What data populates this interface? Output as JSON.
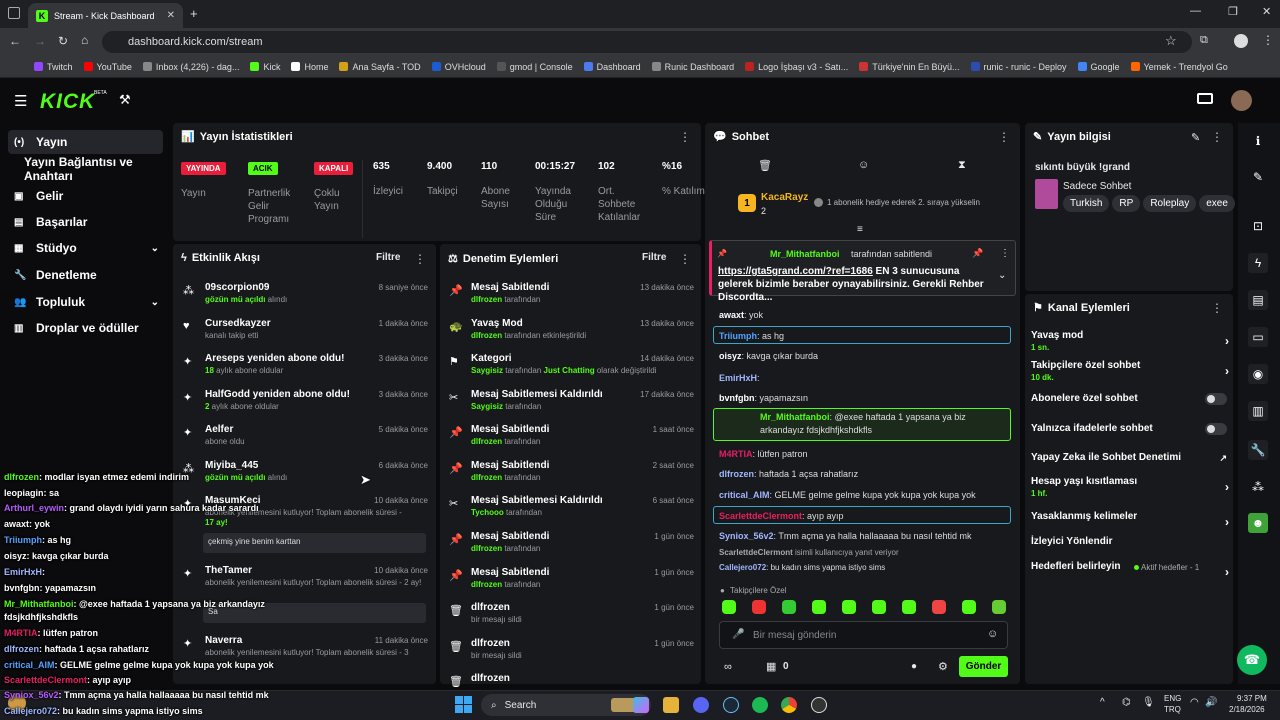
{
  "browser": {
    "tab_title": "Stream - Kick Dashboard",
    "url": "dashboard.kick.com/stream",
    "bookmarks": [
      "Twitch",
      "YouTube",
      "Inbox (4,226) - dag...",
      "Kick",
      "Home",
      "Ana Sayfa - TOD",
      "OVHcloud",
      "gmod | Console",
      "Dashboard",
      "Runic Dashboard",
      "Logo İşbaşı v3 - Satı...",
      "Türkiye'nin En Büyü...",
      "runic - runic - Deploy",
      "Google",
      "Yemek - Trendyol Go"
    ]
  },
  "sidebar": {
    "items": [
      "Yayın",
      "Yayın Bağlantısı ve Anahtarı",
      "Gelir",
      "Başarılar",
      "Stüdyo",
      "Denetleme",
      "Topluluk",
      "Droplar ve ödüller"
    ]
  },
  "stats": {
    "title": "Yayın İstatistikleri",
    "badges": [
      {
        "text": "YAYINDA",
        "label": "Yayın"
      },
      {
        "text": "ACIK",
        "label": "Partnerlik Gelir Programı"
      },
      {
        "text": "KAPALI",
        "label": "Çoklu Yayın"
      }
    ],
    "metrics": [
      {
        "value": "635",
        "label": "İzleyici"
      },
      {
        "value": "9.400",
        "label": "Takipçi"
      },
      {
        "value": "110",
        "label": "Abone Sayısı"
      },
      {
        "value": "00:15:27",
        "label": "Yayında Olduğu Süre"
      },
      {
        "value": "102",
        "label": "Ort. Sohbete Katılanlar"
      },
      {
        "value": "%16",
        "label": "% Katılım"
      }
    ]
  },
  "activity": {
    "title": "Etkinlik Akışı",
    "filter": "Filtre",
    "items": [
      {
        "title": "09scorpion09",
        "sub_hl": "gözün mü açıldı",
        "sub": " alındı",
        "time": "8 saniye önce"
      },
      {
        "title": "Cursedkayzer",
        "sub_hl": "",
        "sub": "kanalı takip etti",
        "time": "1 dakika önce"
      },
      {
        "title": "Areseps yeniden abone oldu!",
        "sub_hl": "18",
        "sub": " aylık abone oldular",
        "time": "3 dakika önce"
      },
      {
        "title": "HalfGodd yeniden abone oldu!",
        "sub_hl": "2",
        "sub": " aylık abone oldular",
        "time": "3 dakika önce"
      },
      {
        "title": "Aelfer",
        "sub_hl": "",
        "sub": "abone oldu",
        "time": "5 dakika önce"
      },
      {
        "title": "Miyiba_445",
        "sub_hl": "gözün mü açıldı",
        "sub": " alındı",
        "time": "6 dakika önce"
      },
      {
        "title": "MasumKeci",
        "sub_hl": "",
        "sub": "abonelik yenilemesini kutluyor! Toplam abonelik süresi - ",
        "sub2": "17 ay!",
        "msg": "çekmiş yine benim karttan",
        "time": "10 dakika önce"
      },
      {
        "title": "TheTamer",
        "sub_hl": "",
        "sub": "abonelik yenilemesini kutluyor! Toplam abonelik süresi - 2 ay!",
        "msg": "Sa",
        "time": "10 dakika önce"
      },
      {
        "title": "Naverra",
        "sub_hl": "",
        "sub": "abonelik yenilemesini kutluyor! Toplam abonelik süresi - 3",
        "time": "11 dakika önce"
      }
    ]
  },
  "moderation": {
    "title": "Denetim Eylemleri",
    "filter": "Filtre",
    "items": [
      {
        "title": "Mesaj Sabitlendi",
        "who": "dlfrozen",
        "sub": " tarafından",
        "time": "13 dakika önce"
      },
      {
        "title": "Yavaş Mod",
        "who": "dlfrozen",
        "sub": " tarafından etkinleştirildi",
        "time": "13 dakika önce"
      },
      {
        "title": "Kategori",
        "who": "Saygisiz",
        "sub": " tarafından ",
        "extra": "Just Chatting",
        "sub3": " olarak değiştirildi",
        "time": "14 dakika önce"
      },
      {
        "title": "Mesaj Sabitlemesi Kaldırıldı",
        "who": "Saygisiz",
        "sub": " tarafından",
        "time": "17 dakika önce"
      },
      {
        "title": "Mesaj Sabitlendi",
        "who": "dlfrozen",
        "sub": " tarafından",
        "time": "1 saat önce"
      },
      {
        "title": "Mesaj Sabitlendi",
        "who": "dlfrozen",
        "sub": " tarafından",
        "time": "2 saat önce"
      },
      {
        "title": "Mesaj Sabitlemesi Kaldırıldı",
        "who": "Tychooo",
        "sub": " tarafından",
        "time": "6 saat önce"
      },
      {
        "title": "Mesaj Sabitlendi",
        "who": "dlfrozen",
        "sub": " tarafından",
        "time": "1 gün önce"
      },
      {
        "title": "Mesaj Sabitlendi",
        "who": "dlfrozen",
        "sub": " tarafından",
        "time": "1 gün önce"
      },
      {
        "title": "dlfrozen",
        "who": "",
        "sub": "bir mesajı sildi",
        "time": "1 gün önce"
      },
      {
        "title": "dlfrozen",
        "who": "",
        "sub": "bir mesajı sildi",
        "time": "1 gün önce"
      },
      {
        "title": "dlfrozen",
        "who": "",
        "sub": "",
        "time": "1 gün önce"
      }
    ]
  },
  "chat": {
    "title": "Sohbet",
    "gifter": "KacaRayz",
    "gifter_count": "2",
    "gift_text": "1 abonelik hediye ederek 2. sıraya yükselin",
    "pinned_by": "Mr_Mithatfanboi",
    "pinned_suffix": "tarafından sabitlendi",
    "pinned_link": "https://gta5grand.com/?ref=1686",
    "pinned_text": " EN 3 sunucusuna gelerek bizimle beraber oynayabilirsiniz. Gerekli Rehber Discordta...",
    "messages": [
      {
        "user": "awaxt",
        "text": ": yok"
      },
      {
        "user": "Triiumph",
        "text": ": as hg"
      },
      {
        "user": "oisyz",
        "text": ": kavga çıkar burda"
      },
      {
        "user": "EmirHxH",
        "text": ":"
      },
      {
        "user": "bvnfgbn",
        "text": ": yapamazsın"
      },
      {
        "user": "Mr_Mithatfanboi",
        "text": ": @exee haftada 1 yapsana ya biz arkandayız fdsjkdhfjkshdkfls"
      },
      {
        "user": "M4RTIA",
        "text": ": lütfen patron"
      },
      {
        "user": "dlfrozen",
        "text": ": haftada 1 açsa rahatlarız"
      },
      {
        "user": "critical_AIM",
        "text": ": GELME gelme gelme kupa yok kupa yok kupa yok"
      },
      {
        "user": "ScarlettdeClermont",
        "text": ": ayıp ayıp"
      },
      {
        "user": "Syniox_56v2",
        "text": ": Tmm açma ya halla hallaaaaa bu nasıl tehtid mk"
      },
      {
        "user": "ScarlettdeClermont",
        "text": " isimli kullanıcıya yanıt veriyor"
      },
      {
        "user": "Callejero072",
        "text": ": bu kadın sims yapma istiyo sims"
      }
    ],
    "followers_only": "Takipçilere Özel",
    "input_placeholder": "Bir mesaj gönderin",
    "count": "0",
    "send": "Gönder"
  },
  "stream_info": {
    "title": "Yayın bilgisi",
    "stream_title": "sıkıntı büyük !grand",
    "category": "Sadece Sohbet",
    "tags": [
      "Turkish",
      "RP",
      "Roleplay",
      "exee"
    ]
  },
  "channel_actions": {
    "title": "Kanal Eylemleri",
    "items": [
      {
        "label": "Yavaş mod",
        "sub": "1 sn.",
        "kind": "chev"
      },
      {
        "label": "Takipçilere özel sohbet",
        "sub": "10 dk.",
        "kind": "chev"
      },
      {
        "label": "Abonelere özel sohbet",
        "sub": "",
        "kind": "toggle"
      },
      {
        "label": "Yalnızca ifadelerle sohbet",
        "sub": "",
        "kind": "toggle"
      },
      {
        "label": "Yapay Zeka ile Sohbet Denetimi",
        "sub": "",
        "kind": "ext"
      },
      {
        "label": "Hesap yaşı kısıtlaması",
        "sub": "1 hf.",
        "kind": "chev"
      },
      {
        "label": "Yasaklanmış kelimeler",
        "sub": "",
        "kind": "chev"
      },
      {
        "label": "İzleyici Yönlendir",
        "sub": "",
        "kind": "none"
      },
      {
        "label": "Hedefleri belirleyin",
        "sub": "",
        "extra": "Aktif hedefler - 1",
        "kind": "chev"
      }
    ]
  },
  "overlay_chat": [
    {
      "user": "dlfrozen",
      "text": ": modlar isyan etmez edemi indirim"
    },
    {
      "user": "leopiagin",
      "text": ": sa"
    },
    {
      "user": "Arthurl_eywin",
      "text": ": grand olaydı iyidi yarın sahura kadar sarardı"
    },
    {
      "user": "awaxt",
      "text": ": yok"
    },
    {
      "user": "Triiumph",
      "text": ": as hg"
    },
    {
      "user": "oisyz",
      "text": ": kavga çıkar burda"
    },
    {
      "user": "EmirHxH",
      "text": ":"
    },
    {
      "user": "bvnfgbn",
      "text": ": yapamazsın"
    },
    {
      "user": "Mr_Mithatfanboi",
      "text": ": @exee haftada 1 yapsana ya biz arkandayız"
    },
    {
      "user": "",
      "text": "fdsjkdhfjkshdkfls"
    },
    {
      "user": "M4RTIA",
      "text": ": lütfen patron"
    },
    {
      "user": "dlfrozen",
      "text": ": haftada 1 açsa rahatlarız"
    },
    {
      "user": "critical_AIM",
      "text": ": GELME gelme gelme kupa yok kupa yok kupa yok"
    },
    {
      "user": "ScarlettdeClermont",
      "text": ": ayıp ayıp"
    },
    {
      "user": "Syniox_56v2",
      "text": ": Tmm açma ya halla hallaaaaa bu nasıl tehtid mk"
    },
    {
      "user": "Callejero072",
      "text": ": bu kadın sims yapma istiyo sims"
    }
  ],
  "taskbar": {
    "search": "Search",
    "lang1": "ENG",
    "lang2": "TRQ",
    "time": "9:37 PM",
    "date": "2/18/2026"
  },
  "colors": {
    "accent": "#53fc18",
    "bg": "#0b0b0d",
    "panel": "#18191c"
  }
}
